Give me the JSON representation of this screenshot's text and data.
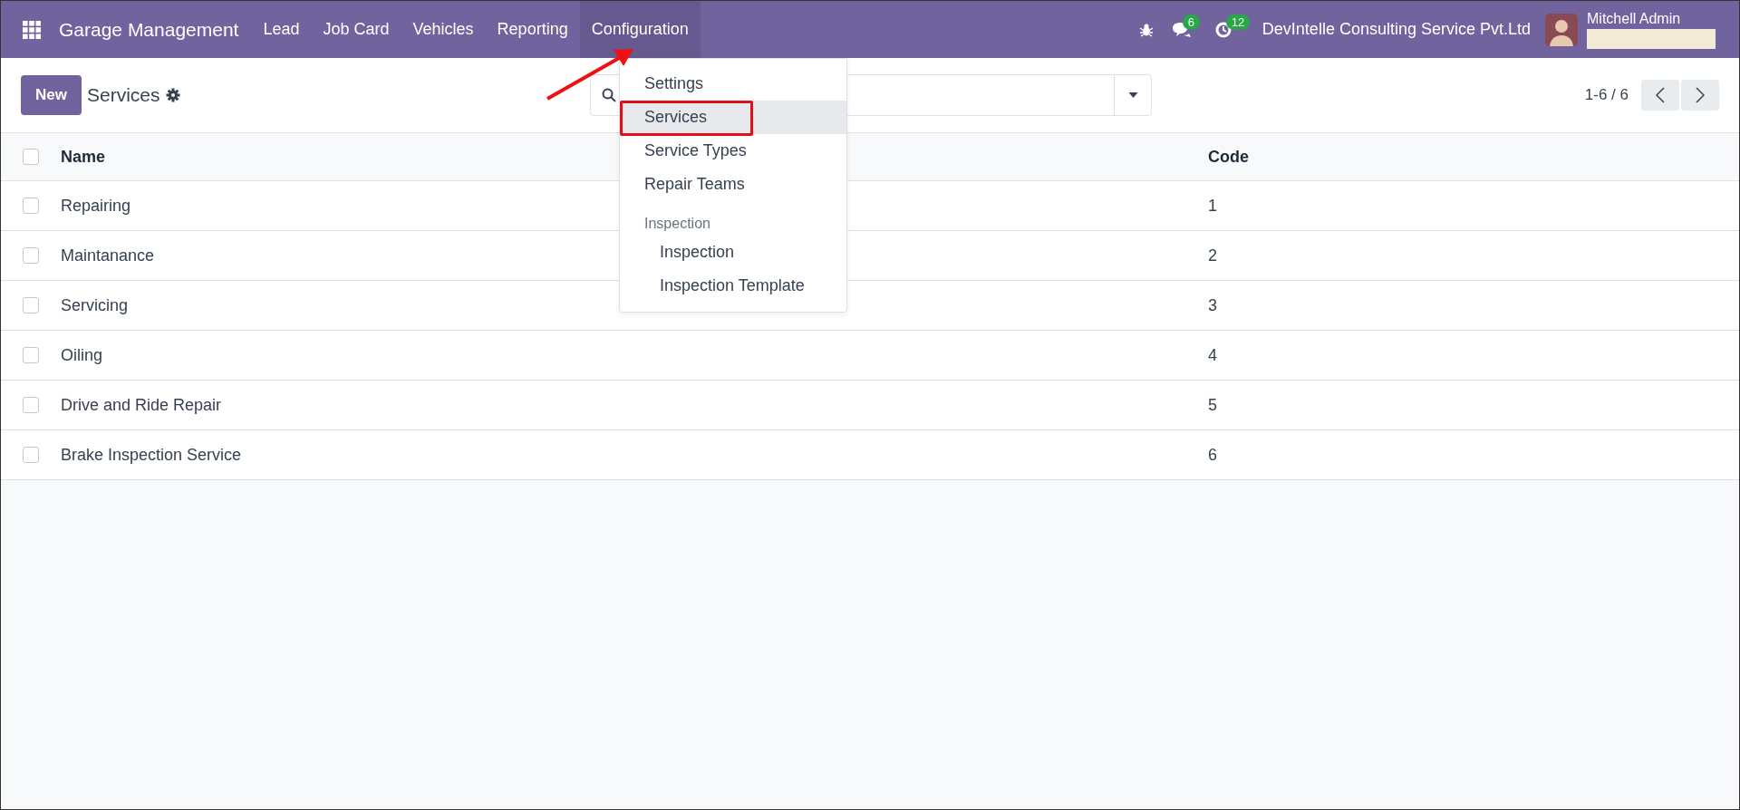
{
  "navbar": {
    "app_name": "Garage Management",
    "menu": [
      {
        "label": "Lead",
        "selected": false
      },
      {
        "label": "Job Card",
        "selected": false
      },
      {
        "label": "Vehicles",
        "selected": false
      },
      {
        "label": "Reporting",
        "selected": false
      },
      {
        "label": "Configuration",
        "selected": true
      }
    ],
    "messages_count": "6",
    "activities_count": "12",
    "company": "DevIntelle Consulting Service Pvt.Ltd",
    "user_name": "Mitchell Admin"
  },
  "control_panel": {
    "new_button": "New",
    "title": "Services",
    "pager": "1-6 / 6"
  },
  "dropdown": {
    "items": [
      {
        "kind": "item",
        "label": "Settings",
        "selected": false,
        "annotated": false
      },
      {
        "kind": "item",
        "label": "Services",
        "selected": true,
        "annotated": true
      },
      {
        "kind": "item",
        "label": "Service Types",
        "selected": false,
        "annotated": false
      },
      {
        "kind": "item",
        "label": "Repair Teams",
        "selected": false,
        "annotated": false
      },
      {
        "kind": "header",
        "label": "Inspection"
      },
      {
        "kind": "subitem",
        "label": "Inspection",
        "selected": false,
        "annotated": false
      },
      {
        "kind": "subitem",
        "label": "Inspection Template",
        "selected": false,
        "annotated": false
      }
    ]
  },
  "table": {
    "select_all_checked": false,
    "columns": [
      "Name",
      "Code"
    ],
    "rows": [
      {
        "name": "Repairing",
        "code": "1",
        "checked": false
      },
      {
        "name": "Maintanance",
        "code": "2",
        "checked": false
      },
      {
        "name": "Servicing",
        "code": "3",
        "checked": false
      },
      {
        "name": "Oiling",
        "code": "4",
        "checked": false
      },
      {
        "name": "Drive and Ride Repair",
        "code": "5",
        "checked": false
      },
      {
        "name": "Brake Inspection Service",
        "code": "6",
        "checked": false
      }
    ]
  }
}
